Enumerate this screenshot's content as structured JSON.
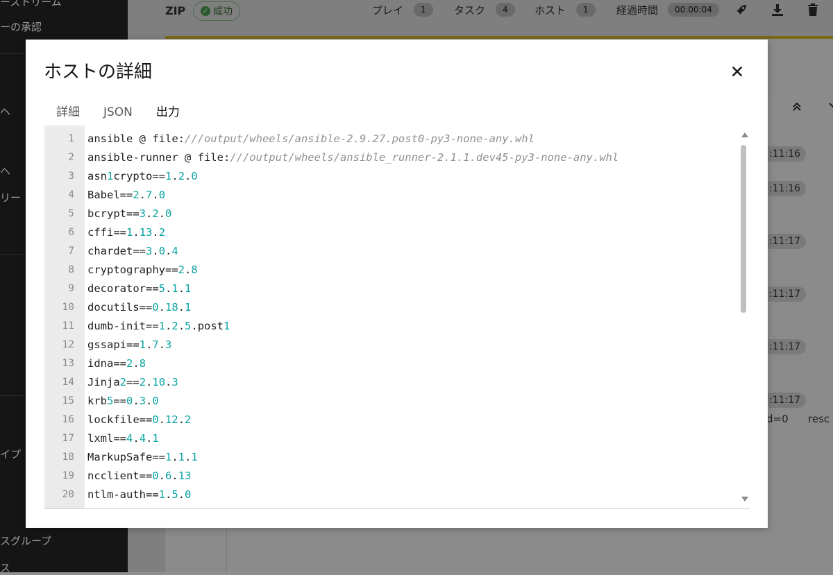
{
  "background": {
    "sidebar_items": [
      "ーストリーム",
      "ーの承認",
      "ヘ",
      "ヘ",
      "リー",
      "イプ",
      "スグループ",
      "ス"
    ],
    "header": {
      "job_name": "ZIP",
      "status": "成功",
      "plays_label": "プレイ",
      "plays_count": "1",
      "tasks_label": "タスク",
      "tasks_count": "4",
      "hosts_label": "ホスト",
      "hosts_count": "1",
      "elapsed_label": "経過時間",
      "elapsed_value": "00:00:04"
    },
    "log_times": [
      ":11:16",
      ":11:16",
      ":11:17",
      ":11:17",
      ":11:17",
      ":11:17"
    ],
    "log_snippet_1": "d=0",
    "log_snippet_2": "resc"
  },
  "modal": {
    "title": "ホストの詳細",
    "close_label": "✕",
    "tabs": [
      {
        "label": "詳細",
        "active": false
      },
      {
        "label": "JSON",
        "active": false
      },
      {
        "label": "出力",
        "active": true
      }
    ]
  },
  "output_lines": [
    {
      "n": "1",
      "text": "ansible @ file:///output/wheels/ansible-2.9.27.post0-py3-none-any.whl"
    },
    {
      "n": "2",
      "text": "ansible-runner @ file:///output/wheels/ansible_runner-2.1.1.dev45-py3-none-any.whl"
    },
    {
      "n": "3",
      "text": "asn1crypto==1.2.0"
    },
    {
      "n": "4",
      "text": "Babel==2.7.0"
    },
    {
      "n": "5",
      "text": "bcrypt==3.2.0"
    },
    {
      "n": "6",
      "text": "cffi==1.13.2"
    },
    {
      "n": "7",
      "text": "chardet==3.0.4"
    },
    {
      "n": "8",
      "text": "cryptography==2.8"
    },
    {
      "n": "9",
      "text": "decorator==5.1.1"
    },
    {
      "n": "10",
      "text": "docutils==0.18.1"
    },
    {
      "n": "11",
      "text": "dumb-init==1.2.5.post1"
    },
    {
      "n": "12",
      "text": "gssapi==1.7.3"
    },
    {
      "n": "13",
      "text": "idna==2.8"
    },
    {
      "n": "14",
      "text": "Jinja2==2.10.3"
    },
    {
      "n": "15",
      "text": "krb5==0.3.0"
    },
    {
      "n": "16",
      "text": "lockfile==0.12.2"
    },
    {
      "n": "17",
      "text": "lxml==4.4.1"
    },
    {
      "n": "18",
      "text": "MarkupSafe==1.1.1"
    },
    {
      "n": "19",
      "text": "ncclient==0.6.13"
    },
    {
      "n": "20",
      "text": "ntlm-auth==1.5.0"
    }
  ],
  "colors": {
    "accent": "#0066cc",
    "number": "#0aa3a3",
    "path": "#909090"
  }
}
